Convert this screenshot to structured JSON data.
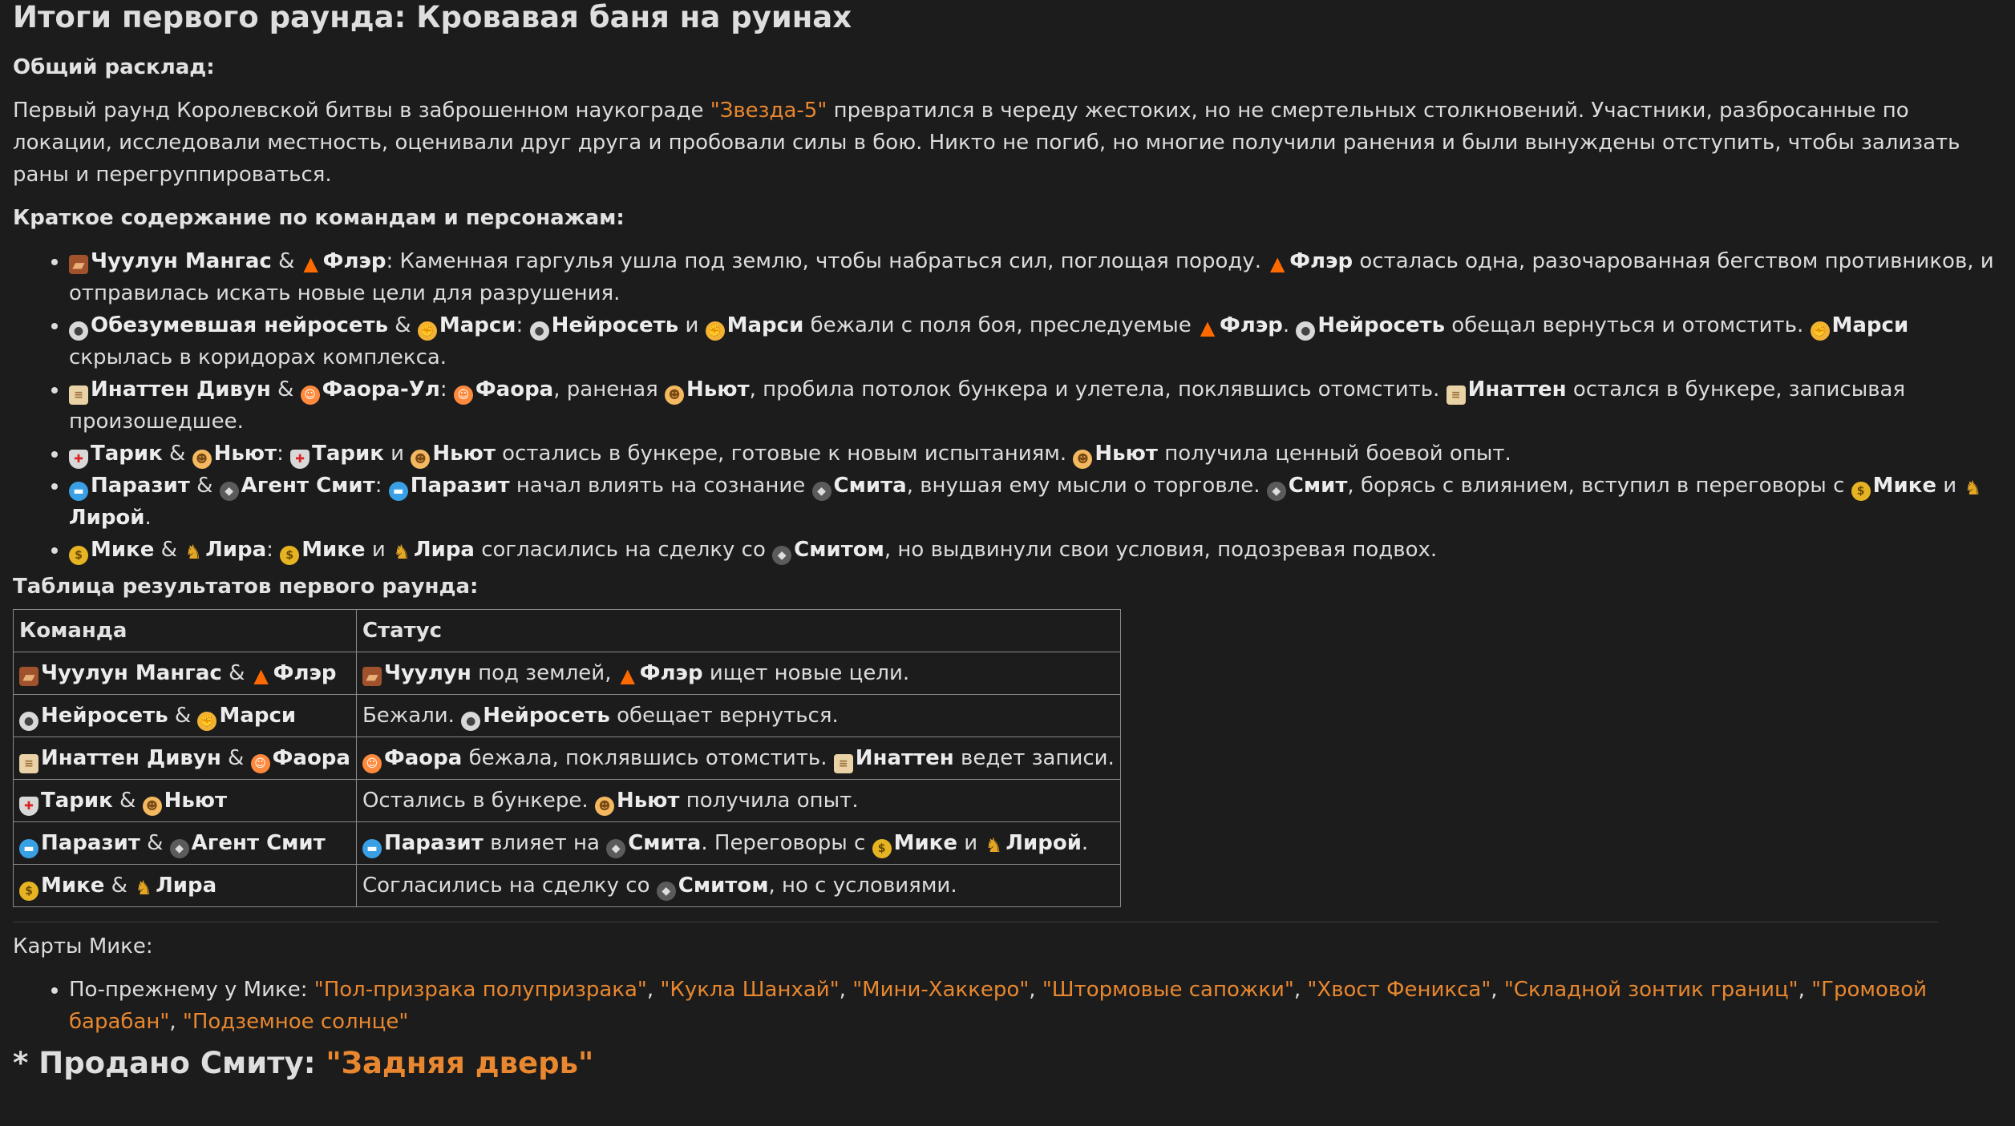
{
  "title": "Итоги первого раунда: Кровавая баня на руинах",
  "overview": {
    "heading": "Общий расклад:",
    "text_before": "Первый раунд Королевской битвы в заброшенном наукограде ",
    "highlight": "\"Звезда-5\"",
    "text_after": " превратился в череду жестоких, но не смертельных столкновений. Участники, разбросанные по локации, исследовали местность, оценивали друг друга и пробовали силы в бою. Никто не погиб, но многие получили ранения и были вынуждены отступить, чтобы зализать раны и перегруппироваться."
  },
  "summary": {
    "heading": "Краткое содержание по командам и персонажам:",
    "items": [
      {
        "segments": [
          {
            "icon": "rock",
            "b": "Чуулун Мангас"
          },
          {
            "t": " & "
          },
          {
            "icon": "fire",
            "b": "Флэр"
          },
          {
            "t": ": Каменная гаргулья ушла под землю, чтобы набраться сил, поглощая породу. "
          },
          {
            "icon": "fire",
            "b": "Флэр"
          },
          {
            "t": " осталась одна, разочарованная бегством противников, и отправилась искать новые цели для разрушения."
          }
        ]
      },
      {
        "segments": [
          {
            "icon": "mask",
            "b": "Обезумевшая нейросеть"
          },
          {
            "t": " & "
          },
          {
            "icon": "fist",
            "b": "Марси"
          },
          {
            "t": ": "
          },
          {
            "icon": "mask",
            "b": "Нейросеть"
          },
          {
            "t": " и "
          },
          {
            "icon": "fist",
            "b": "Марси"
          },
          {
            "t": " бежали с поля боя, преследуемые "
          },
          {
            "icon": "fire",
            "b": "Флэр"
          },
          {
            "t": ". "
          },
          {
            "icon": "mask",
            "b": "Нейросеть"
          },
          {
            "t": " обещал вернуться и отомстить. "
          },
          {
            "icon": "fist",
            "b": "Марси"
          },
          {
            "t": " скрылась в коридорах комплекса."
          }
        ]
      },
      {
        "segments": [
          {
            "icon": "scroll",
            "b": "Инаттен Дивун"
          },
          {
            "t": " & "
          },
          {
            "icon": "elf",
            "b": "Фаора-Ул"
          },
          {
            "t": ": "
          },
          {
            "icon": "elf",
            "b": "Фаора"
          },
          {
            "t": ", раненая "
          },
          {
            "icon": "kid",
            "b": "Ньют"
          },
          {
            "t": ", пробила потолок бункера и улетела, поклявшись отомстить. "
          },
          {
            "icon": "scroll",
            "b": "Инаттен"
          },
          {
            "t": " остался в бункере, записывая произошедшее."
          }
        ]
      },
      {
        "segments": [
          {
            "icon": "shield",
            "b": "Тарик"
          },
          {
            "t": " & "
          },
          {
            "icon": "kid",
            "b": "Ньют"
          },
          {
            "t": ": "
          },
          {
            "icon": "shield",
            "b": "Тарик"
          },
          {
            "t": " и "
          },
          {
            "icon": "kid",
            "b": "Ньют"
          },
          {
            "t": " остались в бункере, готовые к новым испытаниям. "
          },
          {
            "icon": "kid",
            "b": "Ньют"
          },
          {
            "t": " получила ценный боевой опыт."
          }
        ]
      },
      {
        "segments": [
          {
            "icon": "pill",
            "b": "Паразит"
          },
          {
            "t": " & "
          },
          {
            "icon": "agent",
            "b": "Агент Смит"
          },
          {
            "t": ": "
          },
          {
            "icon": "pill",
            "b": "Паразит"
          },
          {
            "t": " начал влиять на сознание "
          },
          {
            "icon": "agent",
            "b": "Смита"
          },
          {
            "t": ", внушая ему мысли о торговле. "
          },
          {
            "icon": "agent",
            "b": "Смит"
          },
          {
            "t": ", борясь с влиянием, вступил в переговоры с "
          },
          {
            "icon": "money",
            "b": "Мике"
          },
          {
            "t": " и "
          },
          {
            "icon": "goat",
            "b": "Лирой"
          },
          {
            "t": "."
          }
        ]
      },
      {
        "segments": [
          {
            "icon": "money",
            "b": "Мике"
          },
          {
            "t": " & "
          },
          {
            "icon": "goat",
            "b": "Лира"
          },
          {
            "t": ": "
          },
          {
            "icon": "money",
            "b": "Мике"
          },
          {
            "t": " и "
          },
          {
            "icon": "goat",
            "b": "Лира"
          },
          {
            "t": " согласились на сделку со "
          },
          {
            "icon": "agent",
            "b": "Смитом"
          },
          {
            "t": ", но выдвинули свои условия, подозревая подвох."
          }
        ]
      }
    ]
  },
  "results": {
    "heading": "Таблица результатов первого раунда:",
    "columns": [
      "Команда",
      "Статус"
    ],
    "rows": [
      {
        "team": [
          {
            "icon": "rock",
            "b": "Чуулун Мангас"
          },
          {
            "t": " & "
          },
          {
            "icon": "fire",
            "b": "Флэр"
          }
        ],
        "status": [
          {
            "icon": "rock",
            "b": "Чуулун"
          },
          {
            "t": " под землей, "
          },
          {
            "icon": "fire",
            "b": "Флэр"
          },
          {
            "t": " ищет новые цели."
          }
        ]
      },
      {
        "team": [
          {
            "icon": "mask",
            "b": "Нейросеть"
          },
          {
            "t": " & "
          },
          {
            "icon": "fist",
            "b": "Марси"
          }
        ],
        "status": [
          {
            "t": "Бежали. "
          },
          {
            "icon": "mask",
            "b": "Нейросеть"
          },
          {
            "t": " обещает вернуться."
          }
        ]
      },
      {
        "team": [
          {
            "icon": "scroll",
            "b": "Инаттен Дивун"
          },
          {
            "t": " & "
          },
          {
            "icon": "elf",
            "b": "Фаора"
          }
        ],
        "status": [
          {
            "icon": "elf",
            "b": "Фаора"
          },
          {
            "t": " бежала, поклявшись отомстить. "
          },
          {
            "icon": "scroll",
            "b": "Инаттен"
          },
          {
            "t": " ведет записи."
          }
        ]
      },
      {
        "team": [
          {
            "icon": "shield",
            "b": "Тарик"
          },
          {
            "t": " & "
          },
          {
            "icon": "kid",
            "b": "Ньют"
          }
        ],
        "status": [
          {
            "t": "Остались в бункере. "
          },
          {
            "icon": "kid",
            "b": "Ньют"
          },
          {
            "t": " получила опыт."
          }
        ]
      },
      {
        "team": [
          {
            "icon": "pill",
            "b": "Паразит"
          },
          {
            "t": " & "
          },
          {
            "icon": "agent",
            "b": "Агент Смит"
          }
        ],
        "status": [
          {
            "icon": "pill",
            "b": "Паразит"
          },
          {
            "t": " влияет на "
          },
          {
            "icon": "agent",
            "b": "Смита"
          },
          {
            "t": ". Переговоры с "
          },
          {
            "icon": "money",
            "b": "Мике"
          },
          {
            "t": " и "
          },
          {
            "icon": "goat",
            "b": "Лирой"
          },
          {
            "t": "."
          }
        ]
      },
      {
        "team": [
          {
            "icon": "money",
            "b": "Мике"
          },
          {
            "t": " & "
          },
          {
            "icon": "goat",
            "b": "Лира"
          }
        ],
        "status": [
          {
            "t": "Согласились на сделку со "
          },
          {
            "icon": "agent",
            "b": "Смитом"
          },
          {
            "t": ", но с условиями."
          }
        ]
      }
    ]
  },
  "cards": {
    "heading": "Карты Мике:",
    "item_prefix": "По-прежнему у Мике: ",
    "list": [
      "\"Пол-призрака полупризрака\"",
      "\"Кукла Шанхай\"",
      "\"Мини-Хаккеро\"",
      "\"Штормовые сапожки\"",
      "\"Хвост Феникса\"",
      "\"Складной зонтик границ\"",
      "\"Громовой барабан\"",
      "\"Подземное солнце\""
    ],
    "sold_prefix": "* Продано Смиту: ",
    "sold_item": "\"Задняя дверь\""
  },
  "icons": {
    "rock": "rock-icon",
    "fire": "fire-icon",
    "mask": "mask-icon",
    "fist": "fist-icon",
    "scroll": "scroll-icon",
    "elf": "elf-icon",
    "kid": "kid-icon",
    "shield": "shield-icon",
    "pill": "pill-icon",
    "agent": "detective-icon",
    "money": "money-bag-icon",
    "goat": "goat-icon"
  },
  "colors": {
    "accent": "#e8872f",
    "background": "#1c1c1c",
    "text": "#dcdcdc"
  }
}
